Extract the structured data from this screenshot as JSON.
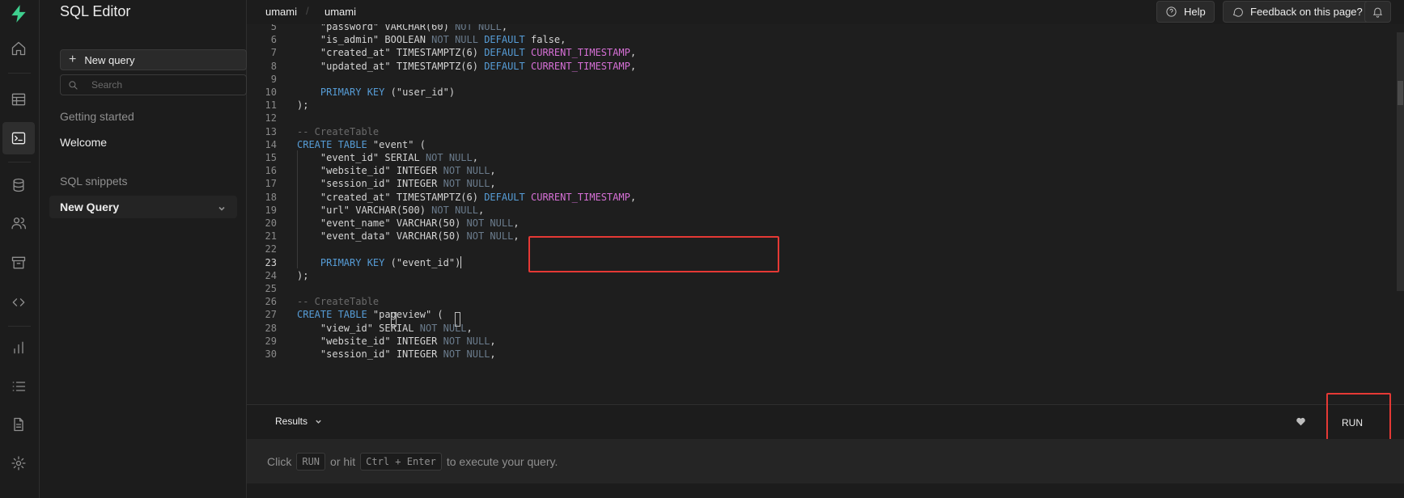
{
  "sidebar": {
    "title": "SQL Editor",
    "new_query_label": "New query",
    "search_placeholder": "Search",
    "getting_started_label": "Getting started",
    "welcome_label": "Welcome",
    "snippets_label": "SQL snippets",
    "active_snippet": "New Query"
  },
  "rail": {
    "icons": [
      "logo-bolt-icon",
      "home-icon",
      "table-icon",
      "terminal-icon",
      "database-icon",
      "users-icon",
      "archive-icon",
      "code-icon",
      "bar-chart-icon",
      "list-icon",
      "document-icon",
      "gear-icon"
    ],
    "active": "terminal-icon",
    "logo_color": "#3ecf8e"
  },
  "topbar": {
    "breadcrumb": [
      "umami",
      "umami"
    ],
    "help_label": "Help",
    "feedback_label": "Feedback on this page?"
  },
  "editor": {
    "colors": {
      "keyword": "#569cd6",
      "not_null": "#6a7b8c",
      "function": "#d670d6",
      "comment": "#6a6a6a",
      "highlight": "#e53935"
    },
    "current_line": 23,
    "lines": [
      {
        "n": "5",
        "code": "    \"password\" VARCHAR(60) NOT NULL,"
      },
      {
        "n": "6",
        "code": "    \"is_admin\" BOOLEAN NOT NULL DEFAULT false,"
      },
      {
        "n": "7",
        "code": "    \"created_at\" TIMESTAMPTZ(6) DEFAULT CURRENT_TIMESTAMP,"
      },
      {
        "n": "8",
        "code": "    \"updated_at\" TIMESTAMPTZ(6) DEFAULT CURRENT_TIMESTAMP,"
      },
      {
        "n": "9",
        "code": ""
      },
      {
        "n": "10",
        "code": "    PRIMARY KEY (\"user_id\")"
      },
      {
        "n": "11",
        "code": ");"
      },
      {
        "n": "12",
        "code": ""
      },
      {
        "n": "13",
        "code": "-- CreateTable"
      },
      {
        "n": "14",
        "code": "CREATE TABLE \"event\" ("
      },
      {
        "n": "15",
        "code": "    \"event_id\" SERIAL NOT NULL,"
      },
      {
        "n": "16",
        "code": "    \"website_id\" INTEGER NOT NULL,"
      },
      {
        "n": "17",
        "code": "    \"session_id\" INTEGER NOT NULL,"
      },
      {
        "n": "18",
        "code": "    \"created_at\" TIMESTAMPTZ(6) DEFAULT CURRENT_TIMESTAMP,"
      },
      {
        "n": "19",
        "code": "    \"url\" VARCHAR(500) NOT NULL,"
      },
      {
        "n": "20",
        "code": "    \"event_name\" VARCHAR(50) NOT NULL,"
      },
      {
        "n": "21",
        "code": "    \"event_data\" VARCHAR(50) NOT NULL,"
      },
      {
        "n": "22",
        "code": ""
      },
      {
        "n": "23",
        "code": "    PRIMARY KEY (\"event_id\")"
      },
      {
        "n": "24",
        "code": ");"
      },
      {
        "n": "25",
        "code": ""
      },
      {
        "n": "26",
        "code": "-- CreateTable"
      },
      {
        "n": "27",
        "code": "CREATE TABLE \"pageview\" ("
      },
      {
        "n": "28",
        "code": "    \"view_id\" SERIAL NOT NULL,"
      },
      {
        "n": "29",
        "code": "    \"website_id\" INTEGER NOT NULL,"
      },
      {
        "n": "30",
        "code": "    \"session_id\" INTEGER NOT NULL,"
      }
    ]
  },
  "results": {
    "tab_label": "Results",
    "run_label": "RUN",
    "hint_prefix": "Click",
    "hint_run_key": "RUN",
    "hint_mid": "or hit",
    "hint_shortcut": "Ctrl + Enter",
    "hint_suffix": "to execute your query."
  }
}
